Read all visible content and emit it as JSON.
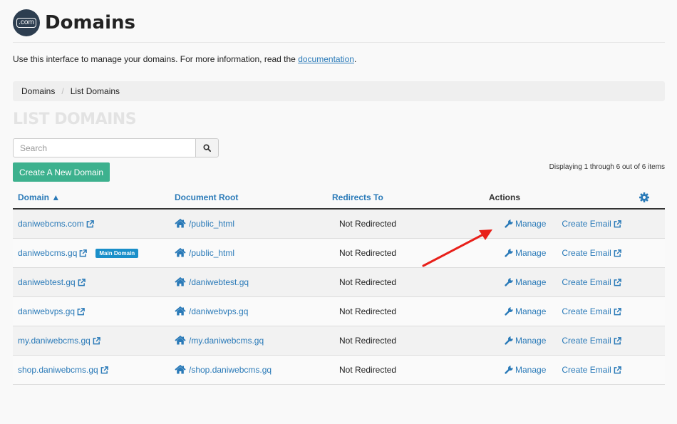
{
  "page": {
    "logo_text": ".com",
    "title": "Domains",
    "intro_text": "Use this interface to manage your domains. For more information, read the ",
    "intro_link": "documentation",
    "intro_end": "."
  },
  "breadcrumb": {
    "items": [
      "Domains",
      "List Domains"
    ],
    "separator": "/"
  },
  "section_title": "LIST DOMAINS",
  "search": {
    "placeholder": "Search"
  },
  "create_button": "Create A New Domain",
  "display_count": "Displaying 1 through 6 out of 6 items",
  "table": {
    "headers": {
      "domain": "Domain ▲",
      "document_root": "Document Root",
      "redirects": "Redirects To",
      "actions": "Actions"
    },
    "rows": [
      {
        "domain": "daniwebcms.com",
        "badge": "",
        "docroot": "/public_html",
        "redirect": "Not Redirected",
        "manage": "Manage",
        "email": "Create Email"
      },
      {
        "domain": "daniwebcms.gq",
        "badge": "Main Domain",
        "docroot": "/public_html",
        "redirect": "Not Redirected",
        "manage": "Manage",
        "email": "Create Email"
      },
      {
        "domain": "daniwebtest.gq",
        "badge": "",
        "docroot": "/daniwebtest.gq",
        "redirect": "Not Redirected",
        "manage": "Manage",
        "email": "Create Email"
      },
      {
        "domain": "daniwebvps.gq",
        "badge": "",
        "docroot": "/daniwebvps.gq",
        "redirect": "Not Redirected",
        "manage": "Manage",
        "email": "Create Email"
      },
      {
        "domain": "my.daniwebcms.gq",
        "badge": "",
        "docroot": "/my.daniwebcms.gq",
        "redirect": "Not Redirected",
        "manage": "Manage",
        "email": "Create Email"
      },
      {
        "domain": "shop.daniwebcms.gq",
        "badge": "",
        "docroot": "/shop.daniwebcms.gq",
        "redirect": "Not Redirected",
        "manage": "Manage",
        "email": "Create Email"
      }
    ]
  },
  "colors": {
    "link": "#2a7ab8",
    "create_button": "#3db18e",
    "badge": "#1a8fc9",
    "annotation_arrow": "#e8201a"
  }
}
